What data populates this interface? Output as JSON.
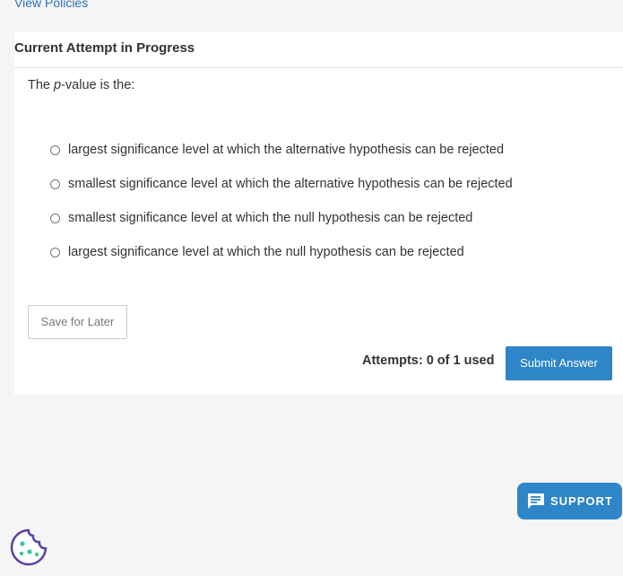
{
  "links": {
    "view_policies": "View Policies"
  },
  "card": {
    "title": "Current Attempt in Progress",
    "question": {
      "prefix": "The ",
      "italic": "p",
      "suffix": "-value is the:"
    },
    "options": [
      {
        "label": "largest significance level at which the alternative hypothesis can be rejected"
      },
      {
        "label": "smallest significance level at which the alternative hypothesis can be rejected"
      },
      {
        "label": "smallest significance level at which the null hypothesis can be rejected"
      },
      {
        "label": "largest significance level at which the null hypothesis can be rejected"
      }
    ],
    "save_label": "Save for Later",
    "attempts_text": "Attempts: 0 of 1 used",
    "submit_label": "Submit Answer"
  },
  "support": {
    "label": "SUPPORT",
    "icon": "chat-icon"
  },
  "cookie": {
    "icon": "cookie-icon"
  },
  "colors": {
    "accent": "#2e86c8",
    "link": "#2b73b6",
    "cookie": "#5b3fa6",
    "cookie_dots": "#3cc4a0"
  }
}
